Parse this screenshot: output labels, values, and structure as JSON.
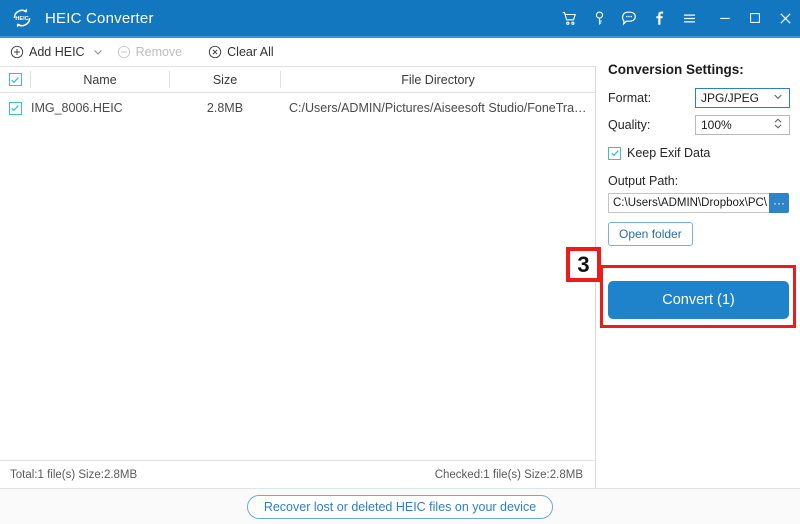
{
  "window": {
    "title": "HEIC Converter",
    "logo_text": "HEIC",
    "icons": {
      "cart": "cart-icon",
      "key": "key-icon",
      "chat": "chat-icon",
      "facebook": "facebook-icon",
      "menu": "menu-icon",
      "minimize": "minimize-icon",
      "maximize": "maximize-icon",
      "close": "close-icon"
    },
    "accent_color": "#1277bf"
  },
  "toolbar": {
    "add_label": "Add HEIC",
    "remove_label": "Remove",
    "clear_label": "Clear All",
    "remove_disabled": true
  },
  "file_list": {
    "columns": [
      "Name",
      "Size",
      "File Directory"
    ],
    "header_checked": true,
    "rows": [
      {
        "checked": true,
        "name": "IMG_8006.HEIC",
        "size": "2.8MB",
        "directory": "C:/Users/ADMIN/Pictures/Aiseesoft Studio/FoneTrans/IMG_80..."
      }
    ]
  },
  "status": {
    "left": "Total:1 file(s) Size:2.8MB",
    "right": "Checked:1 file(s) Size:2.8MB"
  },
  "bottom": {
    "recover_label": "Recover lost or deleted HEIC files on your device"
  },
  "settings": {
    "title": "Conversion Settings:",
    "format_label": "Format:",
    "format_value": "JPG/JPEG",
    "quality_label": "Quality:",
    "quality_value": "100%",
    "exif_label": "Keep Exif Data",
    "exif_checked": true,
    "output_path_label": "Output Path:",
    "output_path_value": "C:\\Users\\ADMIN\\Dropbox\\PC\\",
    "browse_label": "···",
    "open_folder_label": "Open folder",
    "convert_label": "Convert (1)",
    "convert_color": "#1f83cb"
  },
  "annotation": {
    "step_number": "3",
    "highlight_color": "#ee1b1b"
  }
}
